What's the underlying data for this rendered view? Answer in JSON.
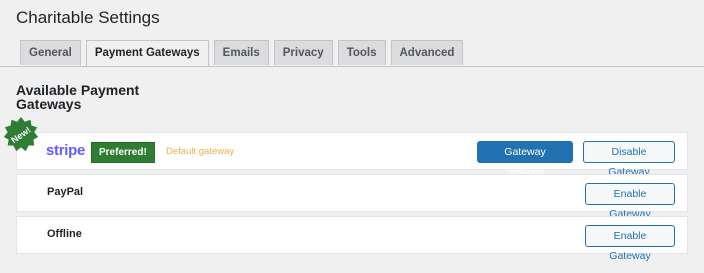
{
  "page": {
    "title": "Charitable Settings"
  },
  "tabs": [
    {
      "label": "General",
      "active": false
    },
    {
      "label": "Payment Gateways",
      "active": true
    },
    {
      "label": "Emails",
      "active": false
    },
    {
      "label": "Privacy",
      "active": false
    },
    {
      "label": "Tools",
      "active": false
    },
    {
      "label": "Advanced",
      "active": false
    }
  ],
  "section": {
    "title": "Available Payment Gateways"
  },
  "badge": {
    "label": "New!",
    "color": "#2e7d32"
  },
  "gateways": [
    {
      "name": "stripe",
      "logo_color": "#635bff",
      "preferred_label": "Preferred!",
      "default_label": "Default gateway",
      "settings_button": "Gateway Settings",
      "toggle_button": "Disable Gateway"
    },
    {
      "name": "PayPal",
      "toggle_button": "Enable Gateway"
    },
    {
      "name": "Offline",
      "toggle_button": "Enable Gateway"
    }
  ],
  "colors": {
    "primary": "#2271b1",
    "background": "#f0f0f1",
    "default_label": "#f0ad4e"
  }
}
